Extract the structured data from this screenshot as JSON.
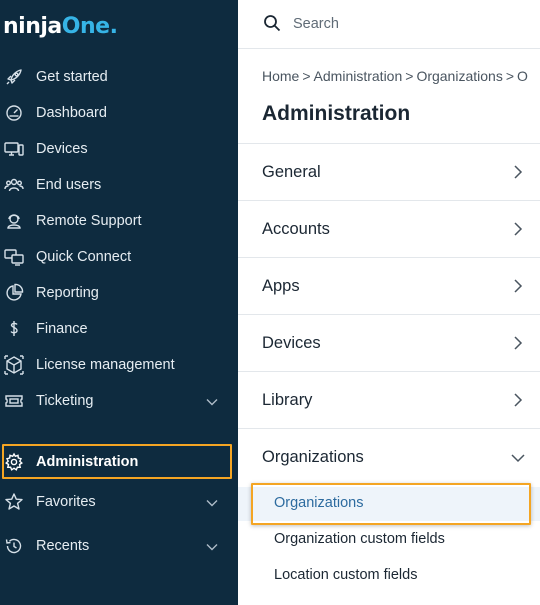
{
  "brand": {
    "logo_text_a": "ninja",
    "logo_text_b": "One",
    "logo_dot": ".",
    "accent": "#36b4e6"
  },
  "colors": {
    "sidebar_bg": "#0e2b3f",
    "highlight": "#f4a523",
    "selected_bg": "#eef4fa",
    "selected_text": "#2d6b9f"
  },
  "sidebar": {
    "items": [
      {
        "label": "Get started",
        "icon": "rocket-icon"
      },
      {
        "label": "Dashboard",
        "icon": "dashboard-gauge-icon"
      },
      {
        "label": "Devices",
        "icon": "devices-icon"
      },
      {
        "label": "End users",
        "icon": "users-icon"
      },
      {
        "label": "Remote Support",
        "icon": "support-agent-icon"
      },
      {
        "label": "Quick Connect",
        "icon": "quick-connect-icon"
      },
      {
        "label": "Reporting",
        "icon": "pie-chart-icon"
      },
      {
        "label": "Finance",
        "icon": "dollar-icon"
      },
      {
        "label": "License management",
        "icon": "license-box-icon"
      },
      {
        "label": "Ticketing",
        "icon": "ticket-icon",
        "expandable": true
      },
      {
        "label": "Administration",
        "icon": "gear-icon",
        "active": true
      },
      {
        "label": "Favorites",
        "icon": "star-icon",
        "expandable": true
      },
      {
        "label": "Recents",
        "icon": "history-icon",
        "expandable": true
      }
    ]
  },
  "search": {
    "placeholder": "Search"
  },
  "breadcrumb": {
    "items": [
      "Home",
      "Administration",
      "Organizations",
      "O"
    ],
    "separator": ">"
  },
  "page": {
    "title": "Administration"
  },
  "sections": [
    {
      "label": "General",
      "expanded": false
    },
    {
      "label": "Accounts",
      "expanded": false
    },
    {
      "label": "Apps",
      "expanded": false
    },
    {
      "label": "Devices",
      "expanded": false
    },
    {
      "label": "Library",
      "expanded": false
    },
    {
      "label": "Organizations",
      "expanded": true
    }
  ],
  "organizations_sub": [
    {
      "label": "Organizations",
      "selected": true
    },
    {
      "label": "Organization custom fields",
      "selected": false
    },
    {
      "label": "Location custom fields",
      "selected": false
    }
  ]
}
